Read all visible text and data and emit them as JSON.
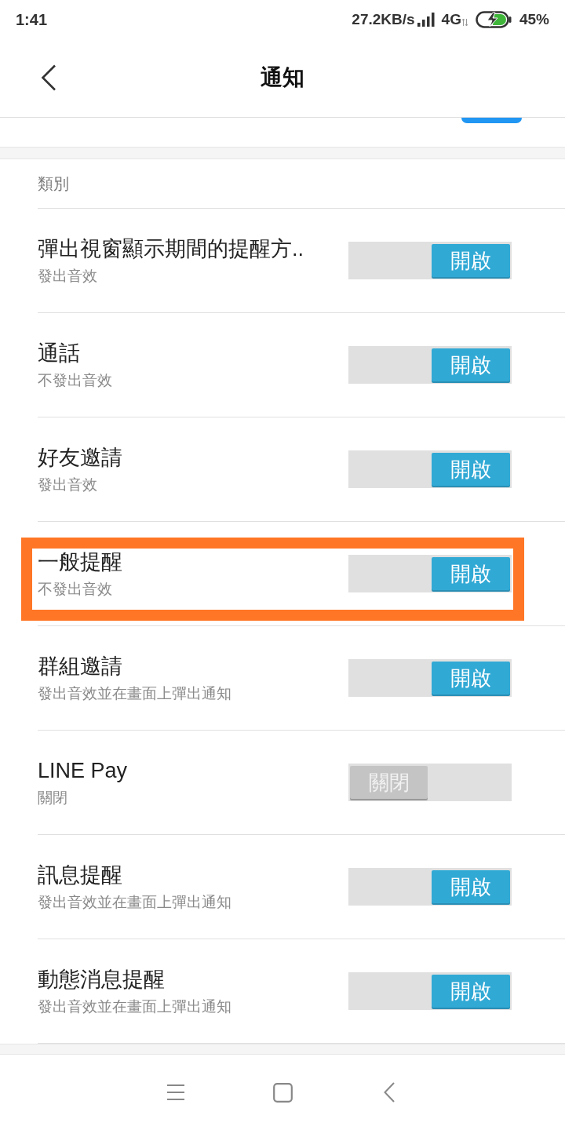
{
  "status_bar": {
    "time": "1:41",
    "net_speed": "27.2KB/s",
    "network": "4G",
    "battery": "45%"
  },
  "header": {
    "title": "通知"
  },
  "top_switch": {
    "on": true
  },
  "section": {
    "title": "類別"
  },
  "rows": [
    {
      "title": "彈出視窗顯示期間的提醒方..",
      "subtitle": "發出音效",
      "on": true,
      "toggle_label": "開啟",
      "highlighted": false
    },
    {
      "title": "通話",
      "subtitle": "不發出音效",
      "on": true,
      "toggle_label": "開啟",
      "highlighted": false
    },
    {
      "title": "好友邀請",
      "subtitle": "發出音效",
      "on": true,
      "toggle_label": "開啟",
      "highlighted": false
    },
    {
      "title": "一般提醒",
      "subtitle": "不發出音效",
      "on": true,
      "toggle_label": "開啟",
      "highlighted": true
    },
    {
      "title": "群組邀請",
      "subtitle": "發出音效並在畫面上彈出通知",
      "on": true,
      "toggle_label": "開啟",
      "highlighted": false
    },
    {
      "title": "LINE Pay",
      "subtitle": "關閉",
      "on": false,
      "toggle_label": "關閉",
      "highlighted": false
    },
    {
      "title": "訊息提醒",
      "subtitle": "發出音效並在畫面上彈出通知",
      "on": true,
      "toggle_label": "開啟",
      "highlighted": false
    },
    {
      "title": "動態消息提醒",
      "subtitle": "發出音效並在畫面上彈出通知",
      "on": true,
      "toggle_label": "開啟",
      "highlighted": false
    }
  ]
}
